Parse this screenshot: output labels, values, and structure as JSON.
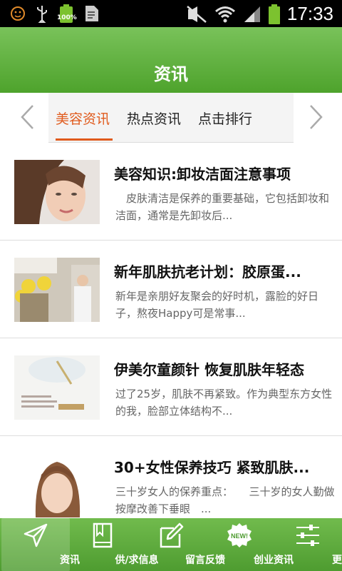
{
  "statusbar": {
    "time": "17:33",
    "battery_small_pct": "100%",
    "icons": [
      "face-icon",
      "usb-icon",
      "battery-icon",
      "document-icon",
      "mute-icon",
      "wifi-icon",
      "signal-icon",
      "battery-icon"
    ]
  },
  "header": {
    "title": "资讯"
  },
  "tabs": {
    "items": [
      {
        "label": "美容资讯",
        "active": true
      },
      {
        "label": "热点资讯",
        "active": false
      },
      {
        "label": "点击排行",
        "active": false
      }
    ],
    "prev_icon": "chevron-left-icon",
    "next_icon": "chevron-right-icon"
  },
  "articles": [
    {
      "title": "美容知识:卸妆洁面注意事项",
      "summary": "　皮肤清洁是保养的重要基础，它包括卸妆和洁面，通常是先卸妆后..."
    },
    {
      "title": "新年肌肤抗老计划：胶原蛋...",
      "summary": "新年是亲朋好友聚会的好时机，露脸的好日子，熬夜Happy可是常事..."
    },
    {
      "title": "伊美尔童颜针 恢复肌肤年轻态",
      "summary": "过了25岁，肌肤不再紧致。作为典型东方女性的我，脸部立体结构不..."
    },
    {
      "title": "30+女性保养技巧 紧致肌肤...",
      "summary": "三十岁女人的保养重点：　　三十岁的女人勤做按摩改善下垂眼　..."
    }
  ],
  "bottom_nav": [
    {
      "label": "资讯",
      "icon": "paper-plane-icon",
      "active": true
    },
    {
      "label": "供/求信息",
      "icon": "book-icon",
      "active": false
    },
    {
      "label": "留言反馈",
      "icon": "edit-icon",
      "active": false
    },
    {
      "label": "创业资讯",
      "icon": "new-badge-icon",
      "badge": "NEW!",
      "active": false
    },
    {
      "label": "更多",
      "icon": "sliders-icon",
      "active": false
    }
  ],
  "colors": {
    "green": "#5cae3a",
    "accent_orange": "#e05a1c",
    "text_dark": "#111111",
    "text_gray": "#666666"
  }
}
